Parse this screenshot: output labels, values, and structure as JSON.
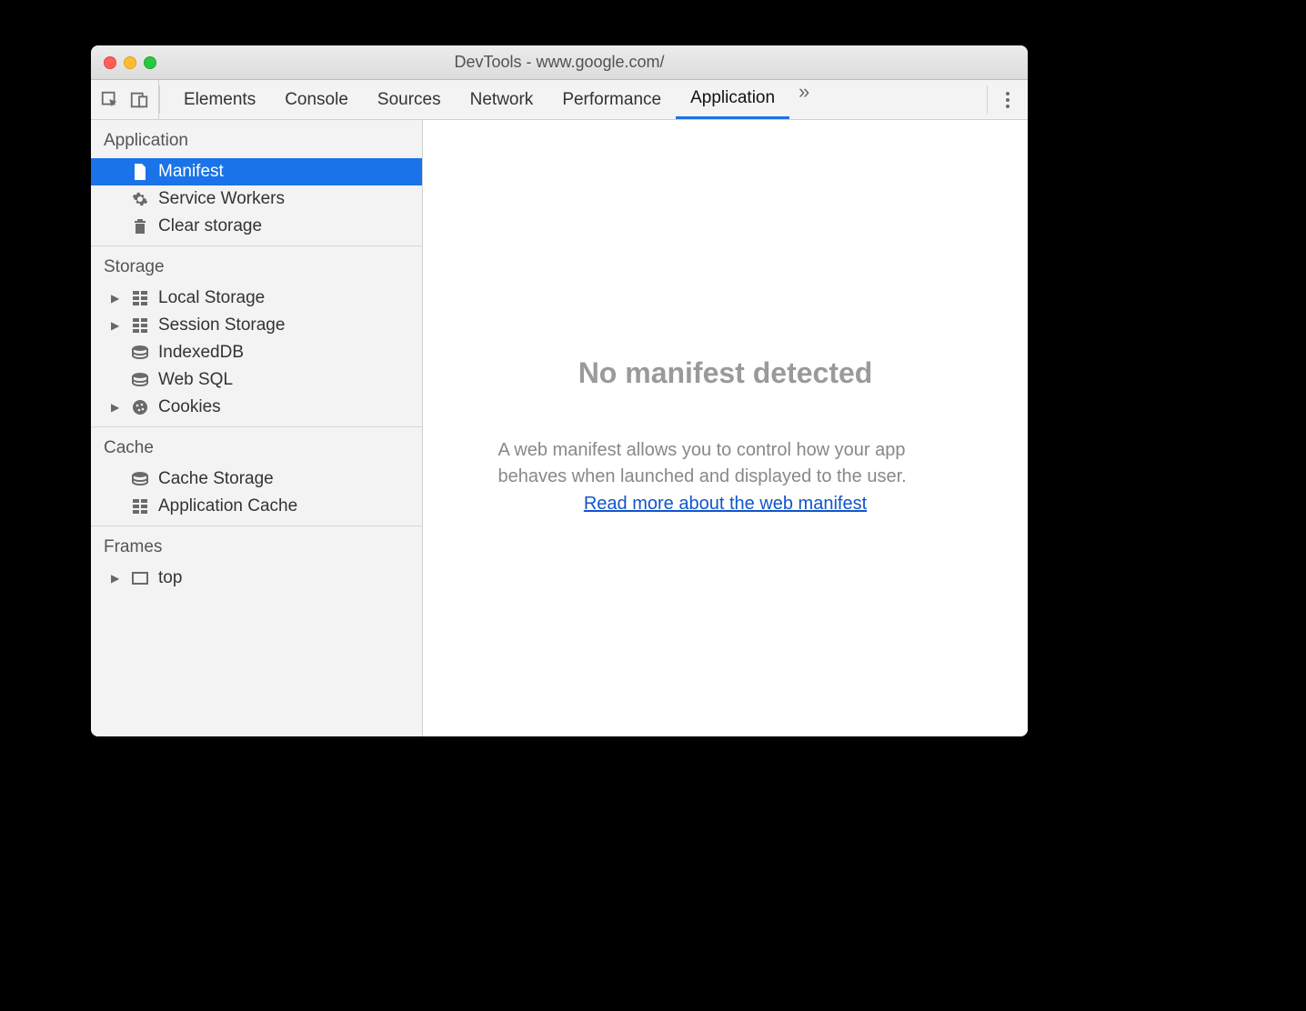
{
  "window": {
    "title": "DevTools - www.google.com/"
  },
  "toolbar": {
    "tabs": [
      {
        "label": "Elements"
      },
      {
        "label": "Console"
      },
      {
        "label": "Sources"
      },
      {
        "label": "Network"
      },
      {
        "label": "Performance"
      },
      {
        "label": "Application",
        "active": true
      }
    ]
  },
  "sidebar": {
    "sections": [
      {
        "title": "Application",
        "items": [
          {
            "label": "Manifest",
            "icon": "file",
            "selected": true
          },
          {
            "label": "Service Workers",
            "icon": "gear"
          },
          {
            "label": "Clear storage",
            "icon": "trash"
          }
        ]
      },
      {
        "title": "Storage",
        "items": [
          {
            "label": "Local Storage",
            "icon": "grid",
            "expandable": true
          },
          {
            "label": "Session Storage",
            "icon": "grid",
            "expandable": true
          },
          {
            "label": "IndexedDB",
            "icon": "db"
          },
          {
            "label": "Web SQL",
            "icon": "db"
          },
          {
            "label": "Cookies",
            "icon": "cookie",
            "expandable": true
          }
        ]
      },
      {
        "title": "Cache",
        "items": [
          {
            "label": "Cache Storage",
            "icon": "db"
          },
          {
            "label": "Application Cache",
            "icon": "grid"
          }
        ]
      },
      {
        "title": "Frames",
        "items": [
          {
            "label": "top",
            "icon": "frame",
            "expandable": true
          }
        ]
      }
    ]
  },
  "main": {
    "heading": "No manifest detected",
    "description": "A web manifest allows you to control how your app behaves when launched and displayed to the user.",
    "link_text": "Read more about the web manifest"
  }
}
